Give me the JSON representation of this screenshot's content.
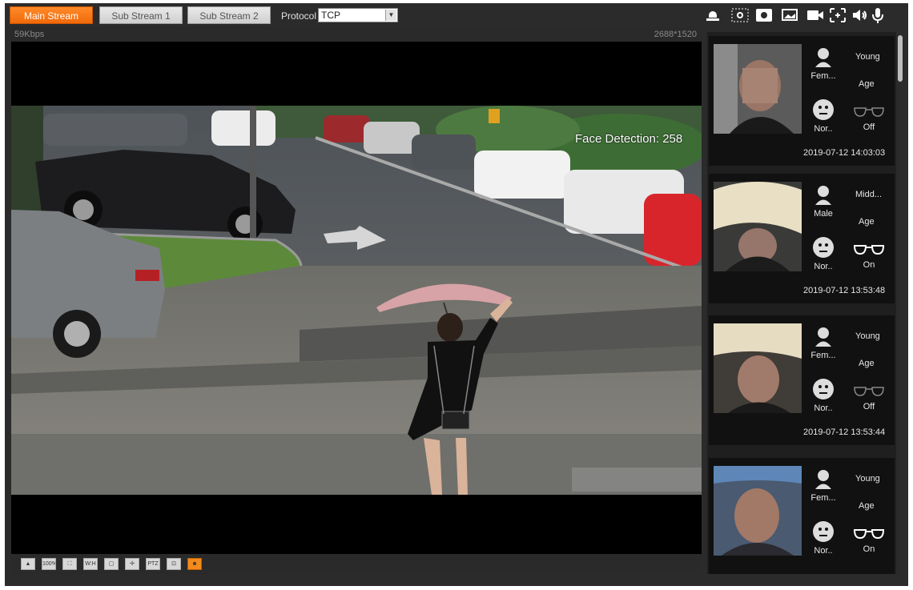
{
  "toolbar": {
    "streams": [
      "Main Stream",
      "Sub Stream 1",
      "Sub Stream 2"
    ],
    "active_stream": "Main Stream",
    "protocol_label": "Protocol",
    "protocol_value": "TCP",
    "icons": [
      "audio-talk-icon",
      "snapshot-region-icon",
      "record-icon",
      "image-icon",
      "video-camera-icon",
      "zoom-icon",
      "speaker-icon",
      "microphone-icon"
    ]
  },
  "video": {
    "bitrate": "59Kbps",
    "resolution": "2688*1520",
    "overlay": "Face Detection: 258"
  },
  "bottom_tools": {
    "icons": [
      "original-size-icon",
      "fisheye-icon",
      "fullscreen-icon",
      "ratio-icon",
      "aspect-icon",
      "ptz-icon",
      "zoom-in-icon",
      "regional-focus-icon",
      "face-detection-icon"
    ],
    "labels": [
      "",
      "100%",
      "",
      "W:H",
      "",
      "",
      "PTZ",
      "",
      ""
    ],
    "active_index": 8
  },
  "faces": [
    {
      "gender": "Fem...",
      "age": "Young",
      "age_label": "Age",
      "expression": "Nor..",
      "glasses": "Off",
      "time": "2019-07-12 14:03:03"
    },
    {
      "gender": "Male",
      "age": "Midd...",
      "age_label": "Age",
      "expression": "Nor..",
      "glasses": "On",
      "time": "2019-07-12 13:53:48"
    },
    {
      "gender": "Fem...",
      "age": "Young",
      "age_label": "Age",
      "expression": "Nor..",
      "glasses": "Off",
      "time": "2019-07-12 13:53:44"
    },
    {
      "gender": "Fem...",
      "age": "Young",
      "age_label": "Age",
      "expression": "Nor..",
      "glasses": "On",
      "time": ""
    }
  ],
  "colors": {
    "accent": "#f07a14",
    "panel": "#1f1f1f",
    "background": "#2b2b2b"
  }
}
